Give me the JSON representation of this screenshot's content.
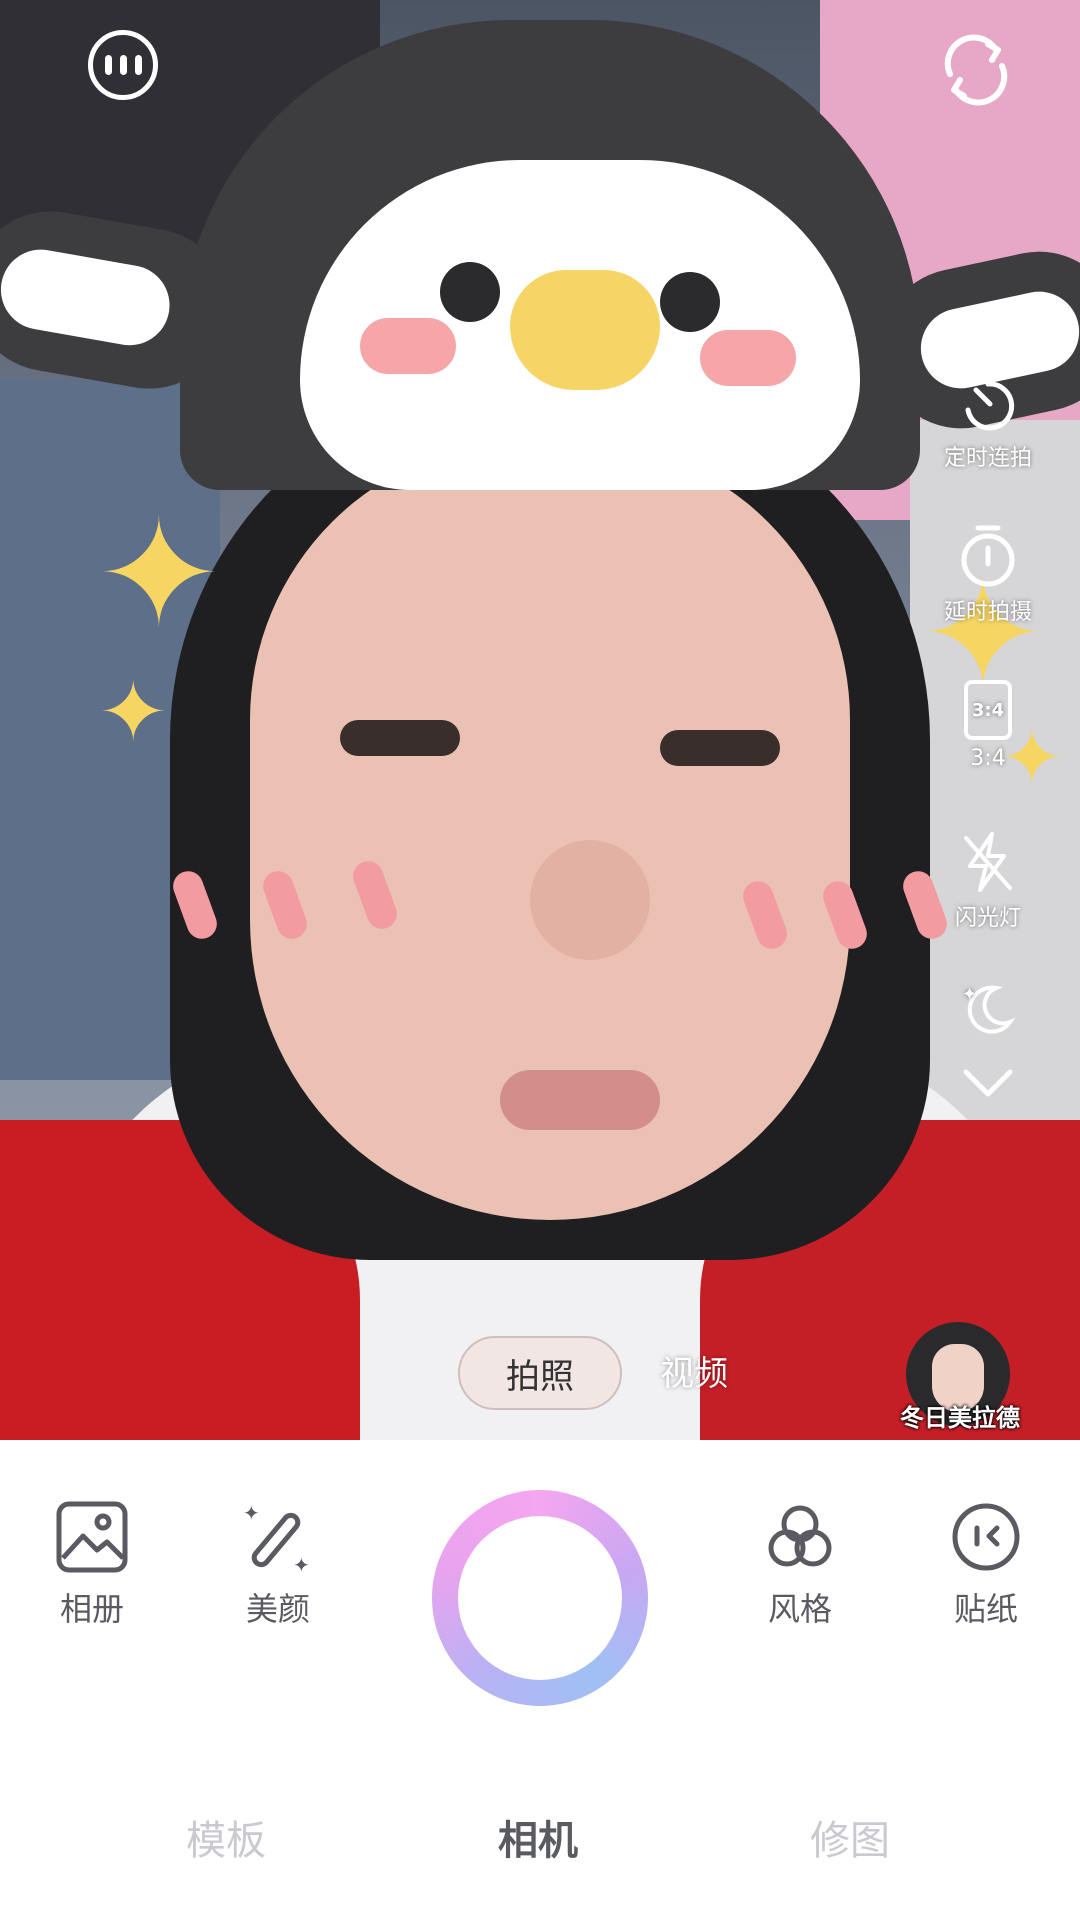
{
  "top": {
    "more_icon": "more-horizontal-icon",
    "flip_icon": "camera-flip-icon"
  },
  "right_tools": {
    "burst": {
      "label": "定时连拍",
      "icon": "burst-timer-icon"
    },
    "delay": {
      "label": "延时拍摄",
      "icon": "stopwatch-icon"
    },
    "ratio": {
      "label": "3:4",
      "icon_text": "3:4",
      "icon": "aspect-ratio-icon"
    },
    "flash": {
      "label": "闪光灯",
      "icon": "flash-off-icon"
    },
    "night": {
      "icon": "night-mode-icon"
    },
    "more": {
      "icon": "chevron-down-icon"
    }
  },
  "modes": {
    "photo": "拍照",
    "video": "视频",
    "selected": "photo"
  },
  "preset": {
    "label": "冬日美拉德"
  },
  "tools": {
    "album": "相册",
    "beauty": "美颜",
    "style": "风格",
    "sticker": "贴纸"
  },
  "bottom_nav": {
    "template": "模板",
    "camera": "相机",
    "retouch": "修图",
    "active": "camera"
  },
  "colors": {
    "accent_gradient": [
      "#f4a6ef",
      "#9fc0f5"
    ],
    "active_nav": "#5a5a62",
    "inactive_nav": "#c9c9d2"
  }
}
